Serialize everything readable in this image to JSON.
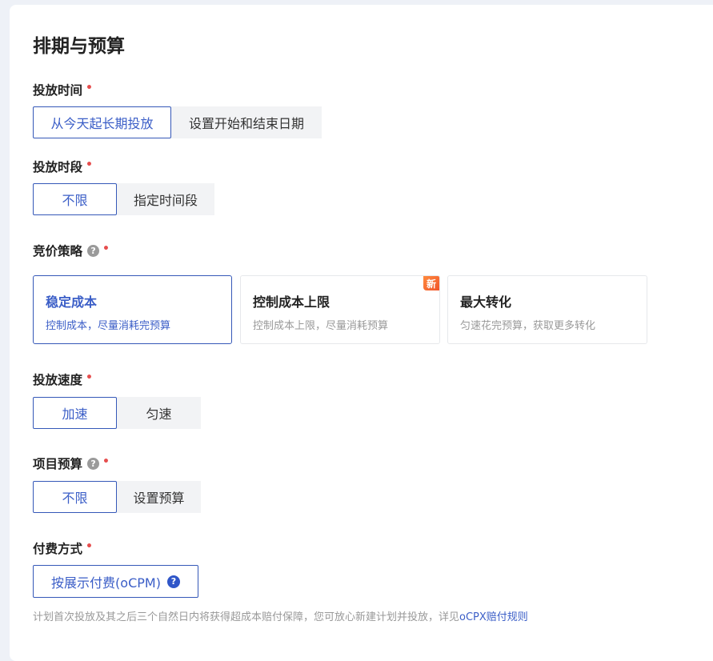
{
  "section": {
    "title": "排期与预算"
  },
  "required_mark": "•",
  "schedule": {
    "label": "投放时间",
    "options": [
      "从今天起长期投放",
      "设置开始和结束日期"
    ],
    "selected": 0
  },
  "time_slot": {
    "label": "投放时段",
    "options": [
      "不限",
      "指定时间段"
    ],
    "selected": 0
  },
  "bid_strategy": {
    "label": "竞价策略",
    "help_glyph": "?",
    "new_badge": "新",
    "options": [
      {
        "title": "稳定成本",
        "desc": "控制成本，尽量消耗完预算"
      },
      {
        "title": "控制成本上限",
        "desc": "控制成本上限，尽量消耗预算"
      },
      {
        "title": "最大转化",
        "desc": "匀速花完预算，获取更多转化"
      }
    ],
    "selected": 0
  },
  "speed": {
    "label": "投放速度",
    "options": [
      "加速",
      "匀速"
    ],
    "selected": 0
  },
  "budget": {
    "label": "项目预算",
    "help_glyph": "?",
    "options": [
      "不限",
      "设置预算"
    ],
    "selected": 0
  },
  "payment": {
    "label": "付费方式",
    "button": "按展示付费(oCPM)",
    "help_glyph": "?",
    "note": "计划首次投放及其之后三个自然日内将获得超成本赔付保障，您可放心新建计划并投放，详见",
    "note_link": "oCPX赔付规则"
  },
  "colors": {
    "accent": "#3b5ec7",
    "required": "#e64e4e",
    "badge": "#f0542b"
  }
}
